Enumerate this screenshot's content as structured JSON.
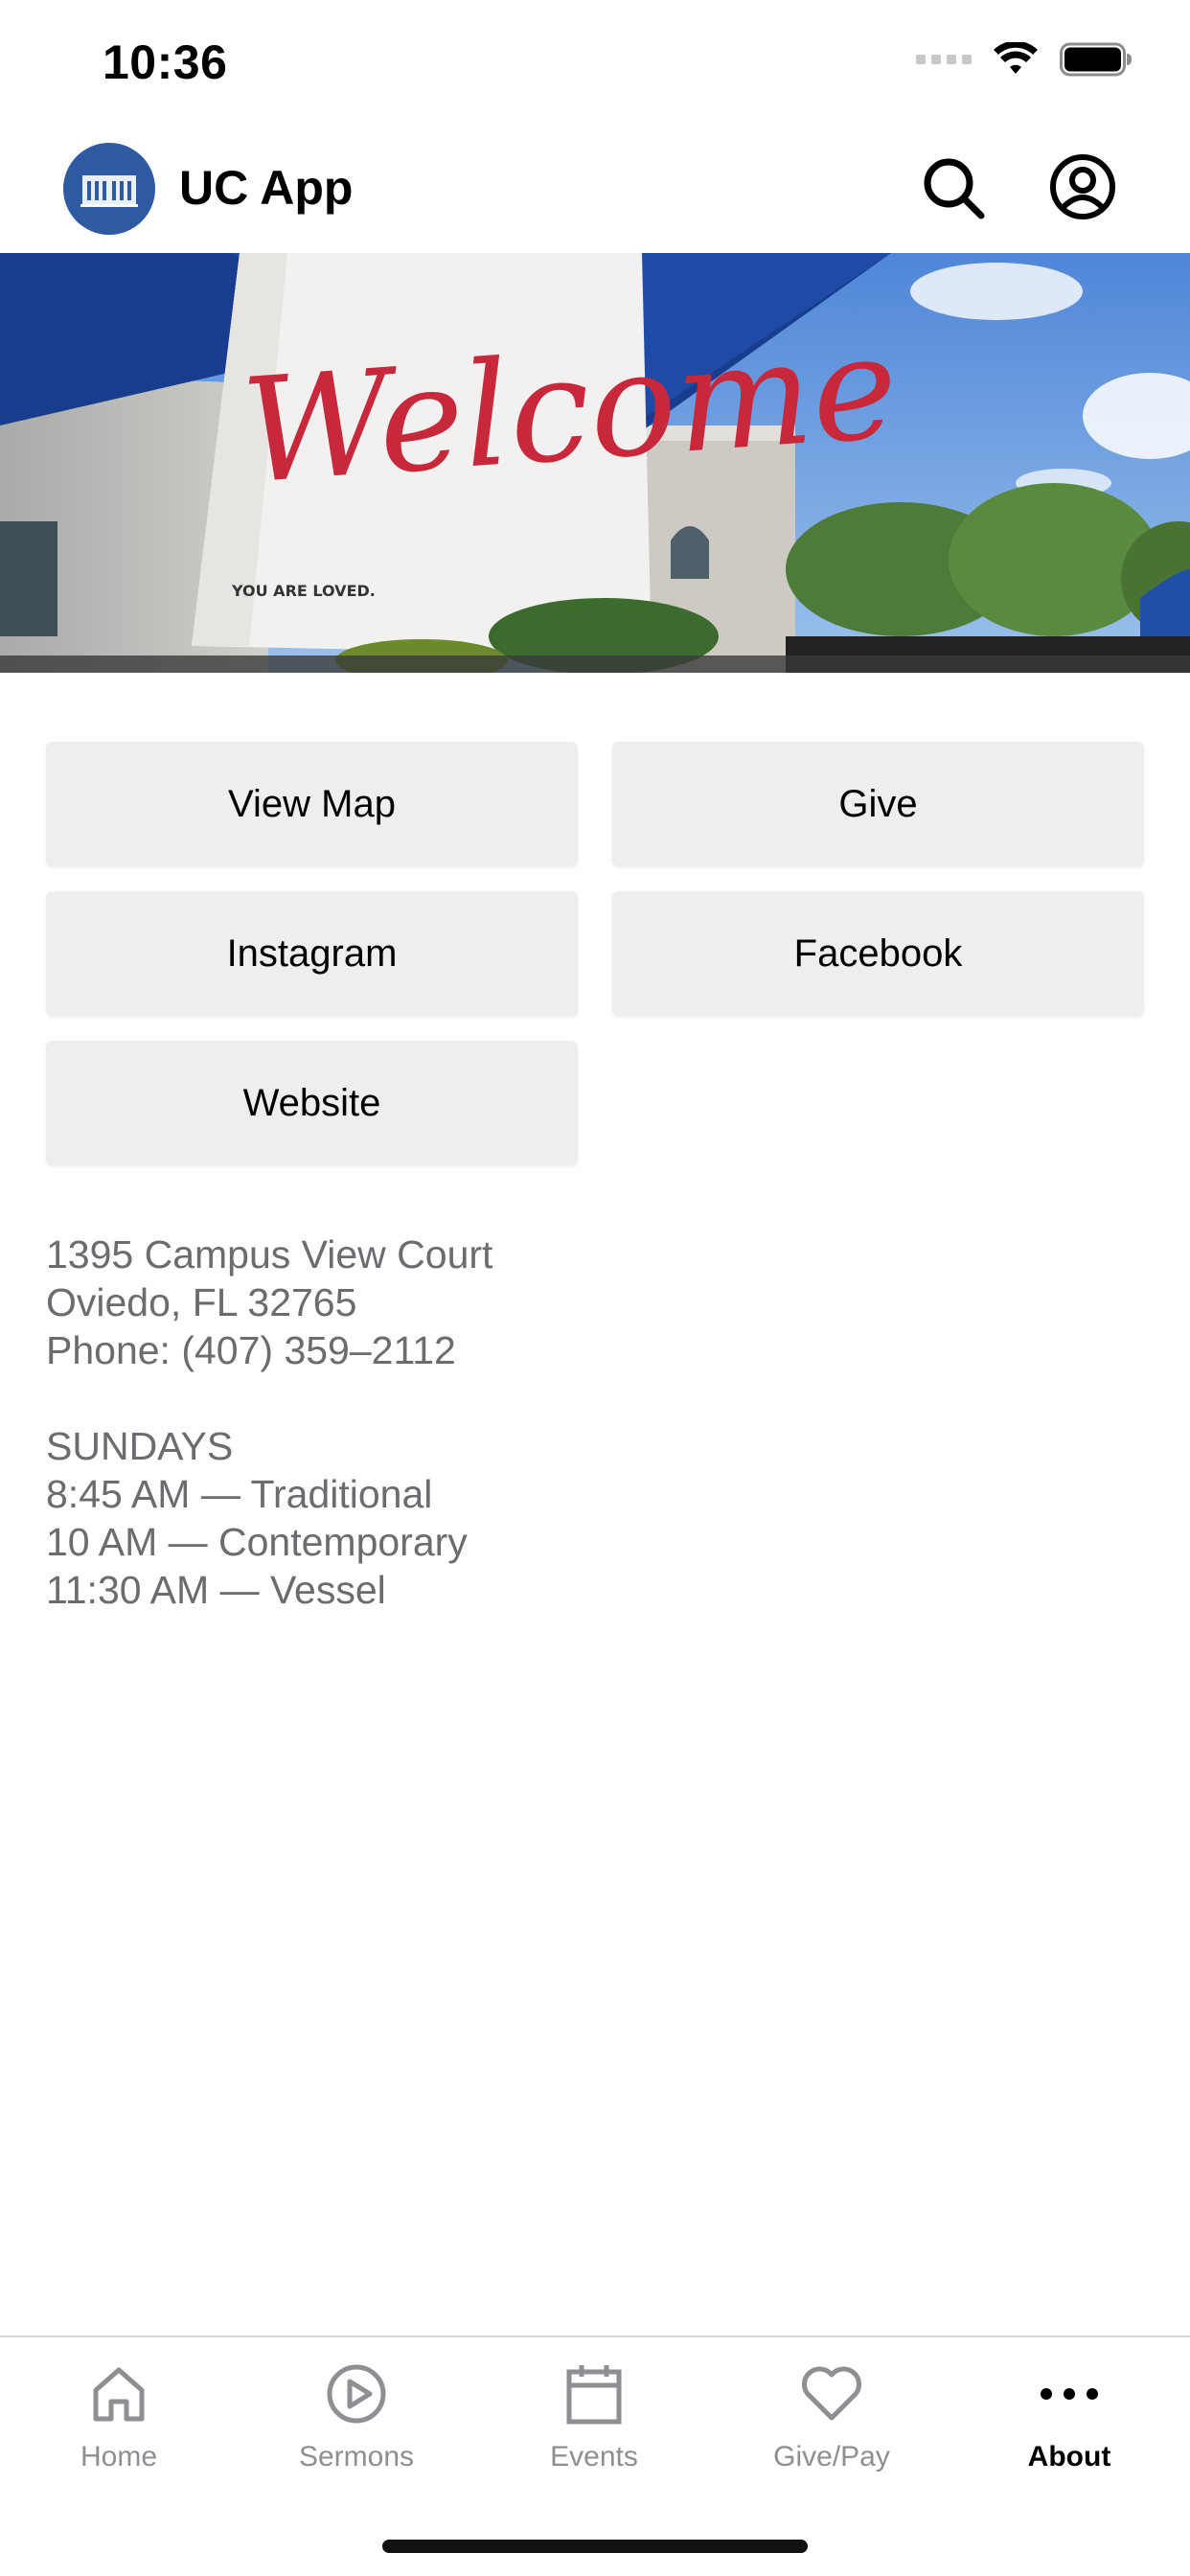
{
  "status_bar": {
    "time": "10:36"
  },
  "header": {
    "title": "UC App"
  },
  "hero": {
    "banner_text": "Welcome",
    "banner_subtext": "YOU ARE LOVED."
  },
  "buttons": {
    "view_map": "View Map",
    "give": "Give",
    "instagram": "Instagram",
    "facebook": "Facebook",
    "website": "Website"
  },
  "info": {
    "address_line1": "1395 Campus View Court",
    "address_line2": "Oviedo, FL 32765",
    "phone": "Phone: (407) 359–2112",
    "schedule_heading": "SUNDAYS",
    "service1": "8:45 AM — Traditional",
    "service2": "10 AM — Contemporary",
    "service3": "11:30 AM — Vessel"
  },
  "tabs": [
    {
      "label": "Home",
      "icon": "home-icon"
    },
    {
      "label": "Sermons",
      "icon": "play-circle-icon"
    },
    {
      "label": "Events",
      "icon": "calendar-icon"
    },
    {
      "label": "Give/Pay",
      "icon": "heart-icon"
    },
    {
      "label": "About",
      "icon": "more-icon"
    }
  ],
  "colors": {
    "brand": "#2e5aa1",
    "button_bg": "#eceef0",
    "inactive_tab": "#8e8e93",
    "banner_red": "#c8283c"
  }
}
